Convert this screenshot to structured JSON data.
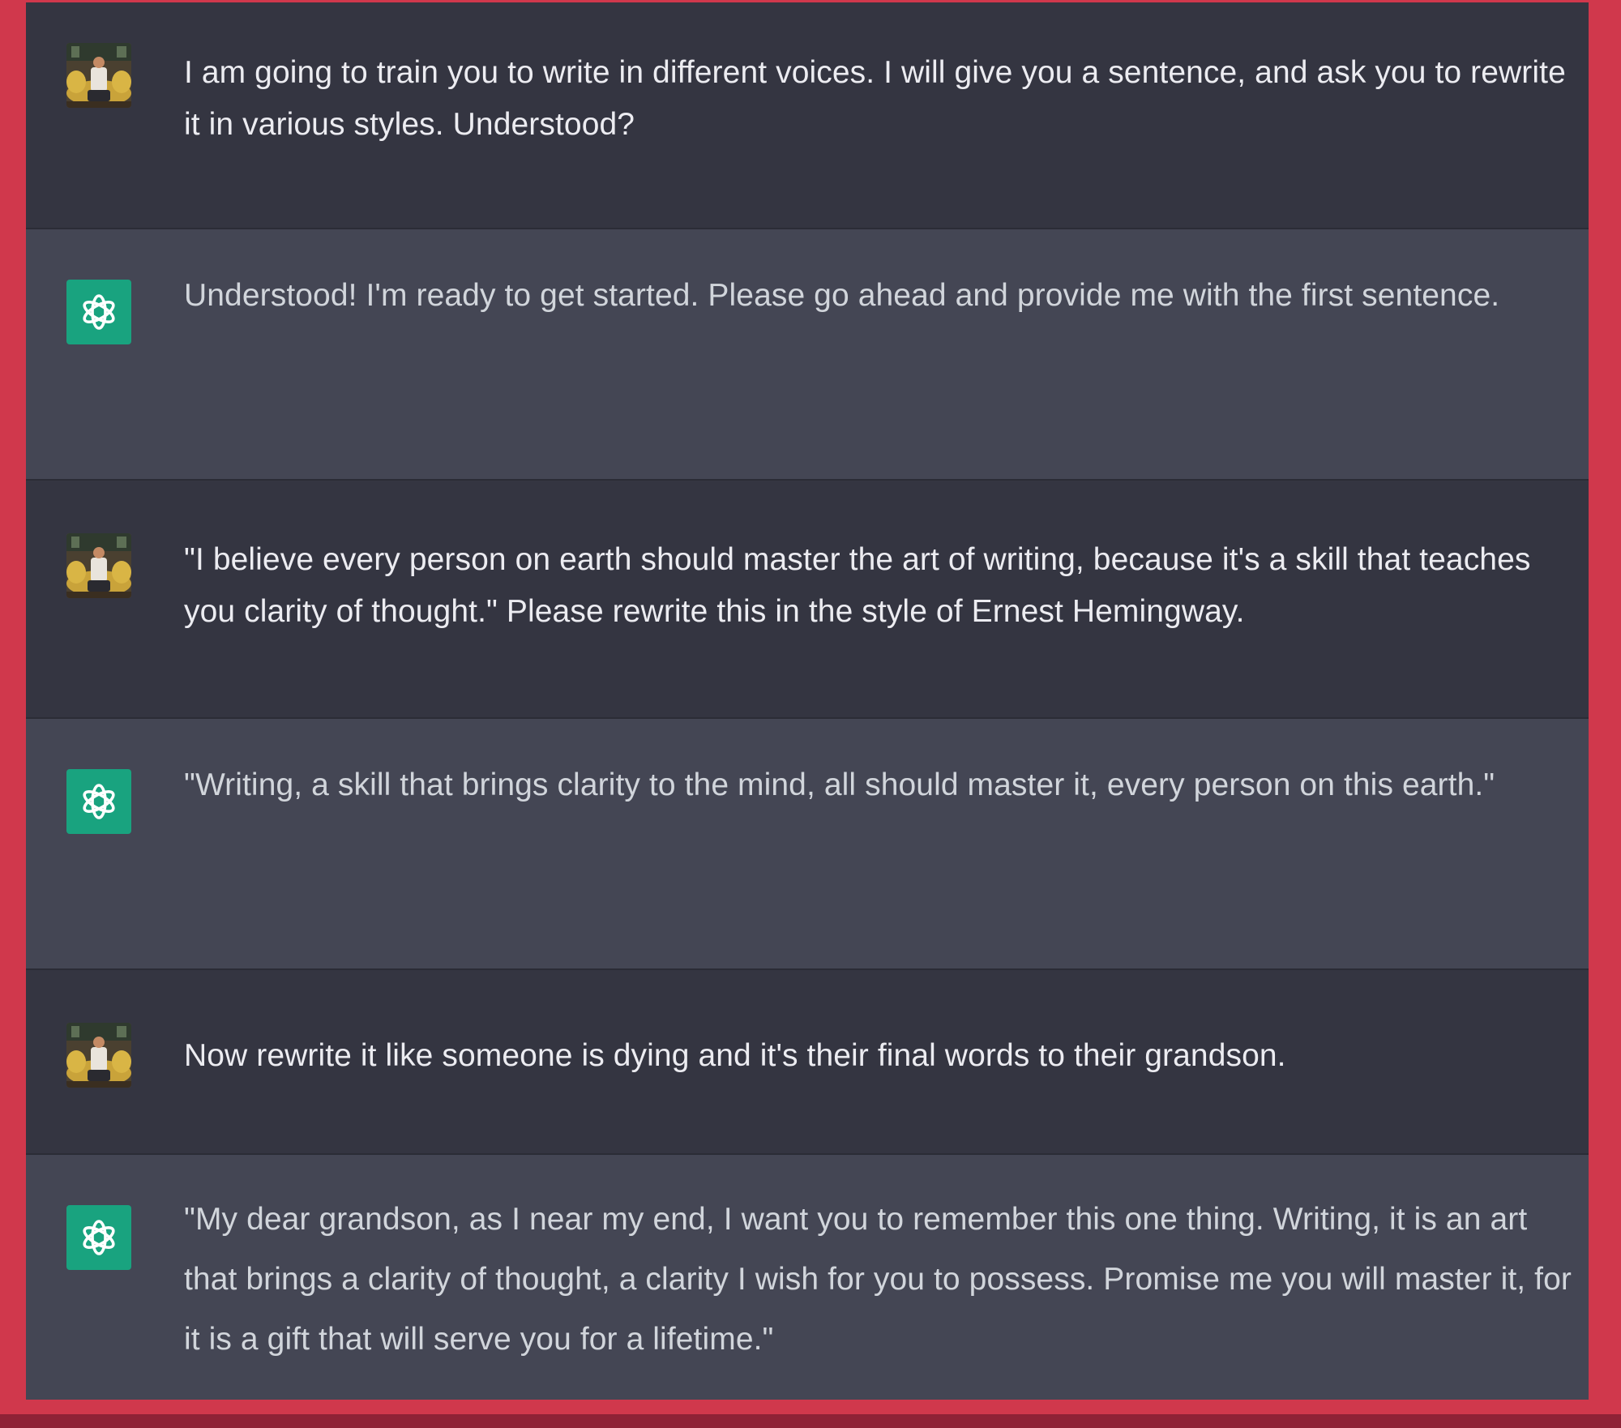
{
  "conversation": {
    "messages": [
      {
        "role": "user",
        "text": "I am going to train you to write in different voices. I will give you a sentence, and ask you to rewrite it in various styles. Understood?"
      },
      {
        "role": "assistant",
        "text": "Understood! I'm ready to get started. Please go ahead and provide me with the first sentence."
      },
      {
        "role": "user",
        "text": "\"I believe every person on earth should master the art of writing, because it's a skill that teaches you clarity of thought.\" Please rewrite this in the style of Ernest Hemingway."
      },
      {
        "role": "assistant",
        "text": "\"Writing, a skill that brings clarity to the mind, all should master it, every person on this earth.\""
      },
      {
        "role": "user",
        "text": "Now rewrite it like someone is dying and it's their final words to their grandson."
      },
      {
        "role": "assistant",
        "text": "\"My dear grandson, as I near my end, I want you to remember this one thing. Writing, it is an art that brings a clarity of thought, a clarity I wish for you to possess. Promise me you will master it, for it is a gift that will serve you for a lifetime.\""
      }
    ]
  },
  "colors": {
    "frame_border": "#d0384c",
    "user_bg": "#343541",
    "assistant_bg": "#444654",
    "assistant_avatar": "#19a37f"
  },
  "icons": {
    "user_avatar": "user-photo-avatar",
    "assistant_avatar": "openai-logo-icon"
  }
}
